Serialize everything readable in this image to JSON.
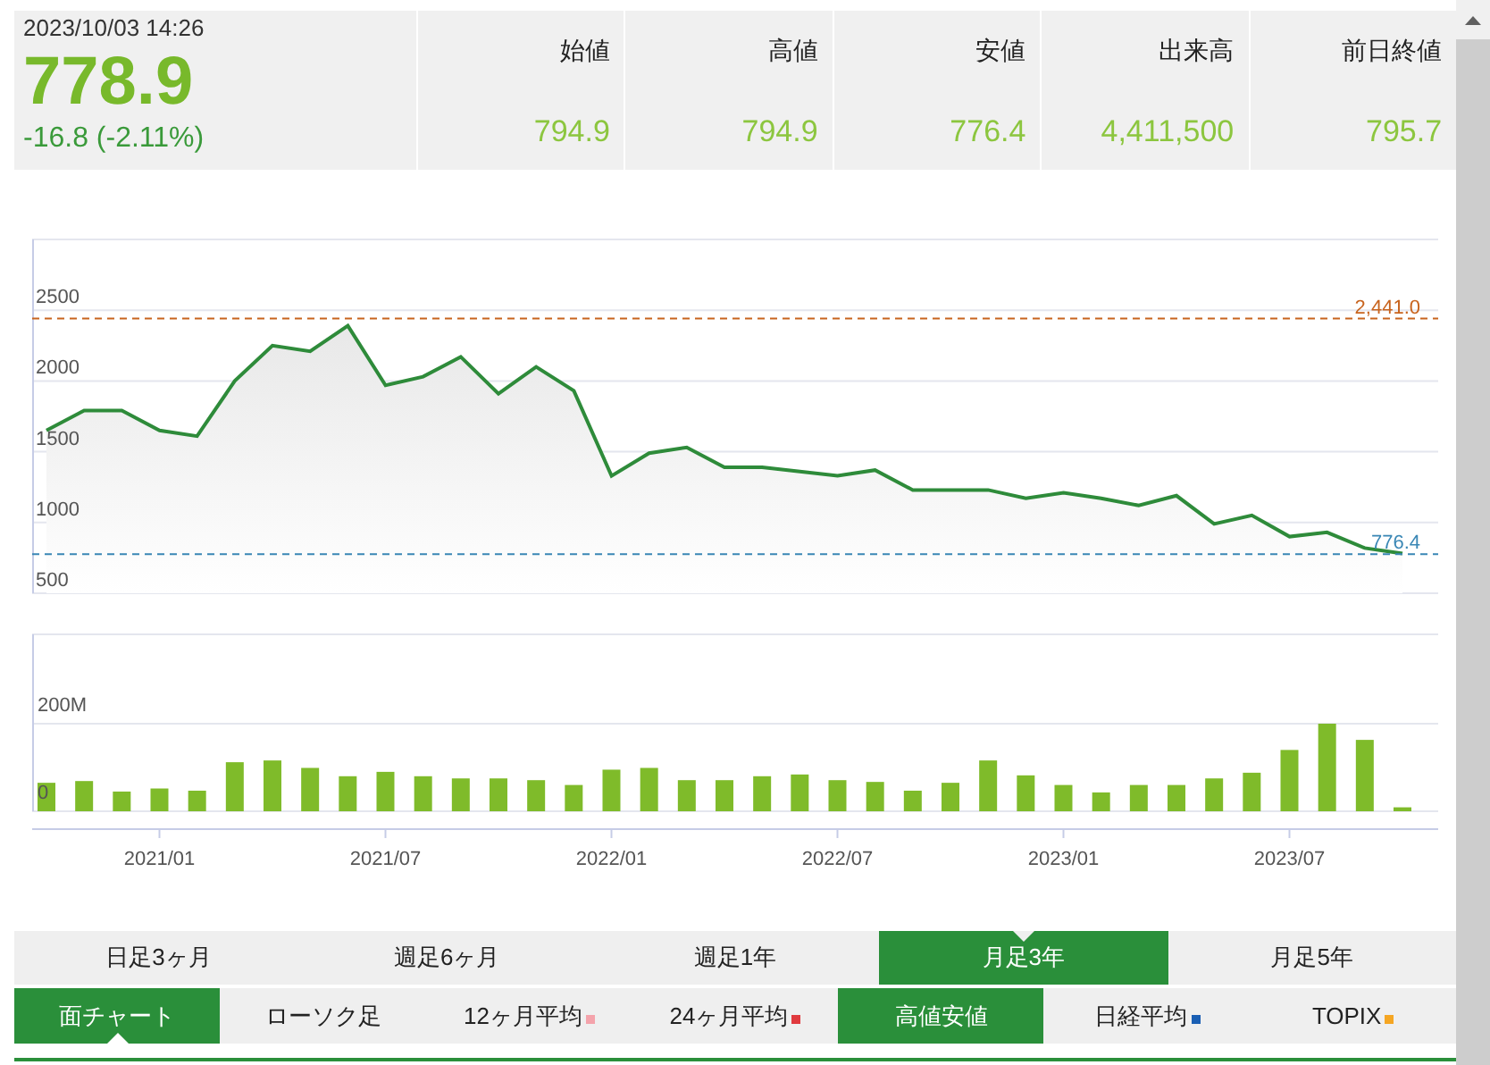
{
  "quote": {
    "datetime": "2023/10/03 14:26",
    "price": "778.9",
    "change": "-16.8 (-2.11%)"
  },
  "stats": [
    {
      "label": "始値",
      "value": "794.9"
    },
    {
      "label": "高値",
      "value": "794.9"
    },
    {
      "label": "安値",
      "value": "776.4"
    },
    {
      "label": "出来高",
      "value": "4,411,500"
    },
    {
      "label": "前日終値",
      "value": "795.7"
    }
  ],
  "price_chart": {
    "chart_data": {
      "type": "area",
      "grid": true,
      "series": [
        {
          "color": "#2e8b3a",
          "values": [
            1650,
            1790,
            1790,
            1650,
            1610,
            2000,
            2250,
            2210,
            2390,
            1970,
            2030,
            2170,
            1910,
            2100,
            1930,
            1330,
            1490,
            1530,
            1390,
            1390,
            1360,
            1330,
            1370,
            1230,
            1230,
            1230,
            1170,
            1210,
            1170,
            1120,
            1190,
            990,
            1050,
            900,
            930,
            820,
            780
          ]
        }
      ],
      "ylim": [
        500,
        3000
      ],
      "yticks": [
        500,
        1000,
        1500,
        2000,
        2500
      ],
      "ref_lines": [
        {
          "axis": "y",
          "value": 2441,
          "label": "2,441.0",
          "color": "#c8641e"
        },
        {
          "axis": "y",
          "value": 776.4,
          "label": "776.4",
          "color": "#3a87b5"
        }
      ]
    }
  },
  "volume_chart": {
    "chart_data": {
      "type": "bar",
      "grid": true,
      "categories": [
        null,
        null,
        null,
        "2021/01",
        null,
        null,
        null,
        null,
        null,
        "2021/07",
        null,
        null,
        null,
        null,
        null,
        "2022/01",
        null,
        null,
        null,
        null,
        null,
        "2022/07",
        null,
        null,
        null,
        null,
        null,
        "2023/01",
        null,
        null,
        null,
        null,
        null,
        "2023/07",
        null,
        null,
        null
      ],
      "series": [
        {
          "color": "#7fbb2a",
          "values": [
            65,
            69,
            45,
            52,
            47,
            112,
            116,
            99,
            80,
            90,
            80,
            75,
            75,
            71,
            60,
            95,
            99,
            71,
            71,
            80,
            84,
            71,
            67,
            47,
            65,
            116,
            82,
            60,
            43,
            60,
            60,
            75,
            88,
            140,
            200,
            163,
            9
          ]
        }
      ],
      "ylim": [
        0,
        404
      ],
      "yticks": [
        {
          "value": 0,
          "label": "0"
        },
        {
          "value": 200,
          "label": "200M"
        }
      ]
    }
  },
  "period_tabs": [
    {
      "label": "日足3ヶ月",
      "selected": false
    },
    {
      "label": "週足6ヶ月",
      "selected": false
    },
    {
      "label": "週足1年",
      "selected": false
    },
    {
      "label": "月足3年",
      "selected": true
    },
    {
      "label": "月足5年",
      "selected": false
    }
  ],
  "chart_options": [
    {
      "kind": "type",
      "label": "面チャート",
      "selected": true
    },
    {
      "kind": "type",
      "label": "ローソク足",
      "selected": false
    },
    {
      "kind": "overlay",
      "label": "12ヶ月平均",
      "selected": false,
      "color": "#f4a3ab"
    },
    {
      "kind": "overlay",
      "label": "24ヶ月平均",
      "selected": false,
      "color": "#e03a3e"
    },
    {
      "kind": "overlay",
      "label": "高値安値",
      "selected": true
    },
    {
      "kind": "overlay",
      "label": "日経平均",
      "selected": false,
      "color": "#1a5fb4"
    },
    {
      "kind": "overlay",
      "label": "TOPIX",
      "selected": false,
      "color": "#f5a623"
    }
  ]
}
